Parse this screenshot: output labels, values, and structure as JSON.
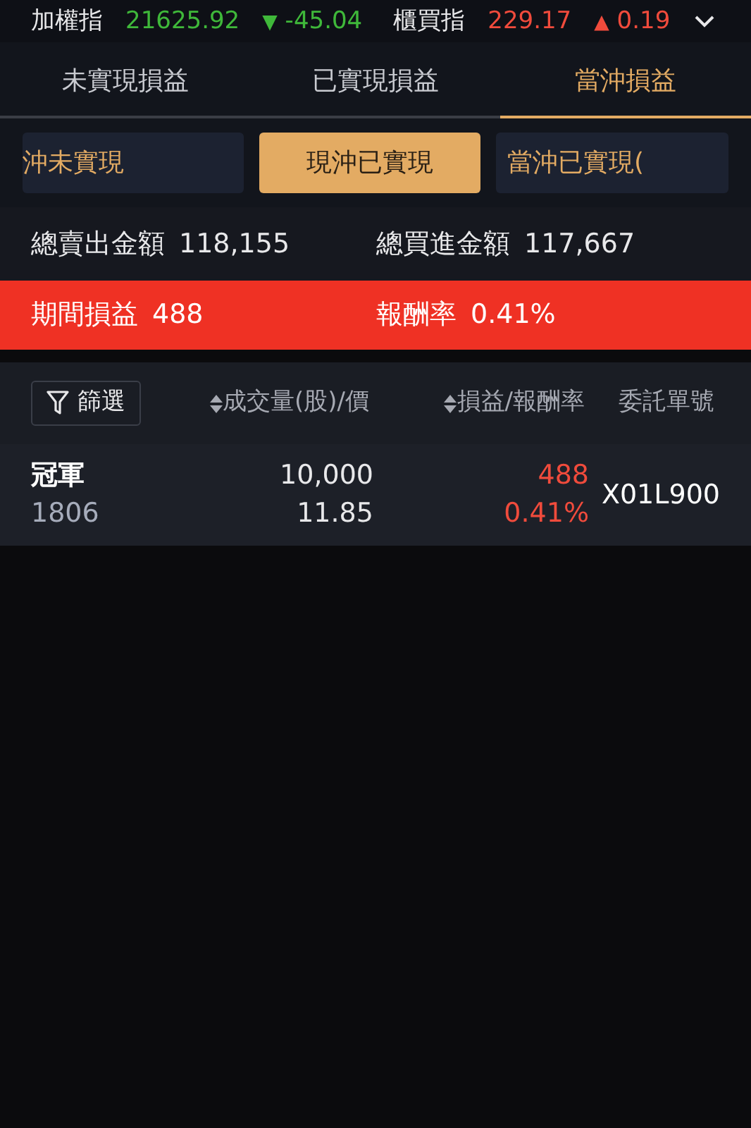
{
  "ticker": [
    {
      "label": "加權指",
      "value": "21625.92",
      "arrow": "▼",
      "change": "-45.04",
      "color": "#3fb83a"
    },
    {
      "label": "櫃買指",
      "value": "229.17",
      "arrow": "▲",
      "change": "0.19",
      "color": "#f04b3c"
    }
  ],
  "tabs": [
    {
      "label": "未實現損益",
      "selected": false
    },
    {
      "label": "已實現損益",
      "selected": false
    },
    {
      "label": "當沖損益",
      "selected": true
    }
  ],
  "sub_tabs": [
    {
      "label": "沖未實現",
      "selected": false
    },
    {
      "label": "現沖已實現",
      "selected": true
    },
    {
      "label": "當沖已實現(",
      "selected": false
    }
  ],
  "summary": [
    {
      "label": "總賣出金額",
      "value": "118,155"
    },
    {
      "label": "總買進金額",
      "value": "117,667"
    }
  ],
  "pnl_band": [
    {
      "label": "期間損益",
      "value": "488"
    },
    {
      "label": "報酬率",
      "value": "0.41%"
    }
  ],
  "table": {
    "filter_button": "篩選",
    "columns": [
      {
        "label": "成交量(股)/價",
        "sortable": true
      },
      {
        "label": "損益/報酬率",
        "sortable": true
      },
      {
        "label": "委託單號",
        "sortable": false
      }
    ],
    "rows": [
      {
        "name": "冠軍",
        "code": "1806",
        "quantity": "10,000",
        "price": "11.85",
        "pnl": "488",
        "return_rate": "0.41%",
        "color": "#f04b3c",
        "order_no": "X01L900"
      }
    ]
  }
}
